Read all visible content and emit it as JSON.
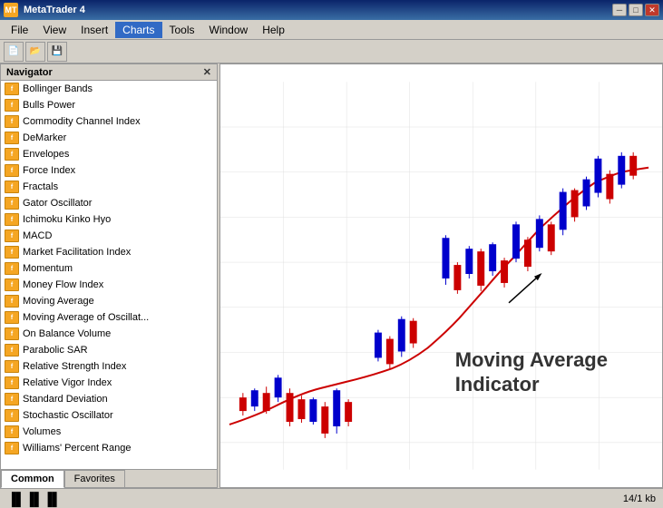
{
  "titleBar": {
    "title": "MetaTrader 4",
    "appIconLabel": "MT"
  },
  "menuBar": {
    "items": [
      "File",
      "View",
      "Insert",
      "Charts",
      "Tools",
      "Window",
      "Help"
    ]
  },
  "navigator": {
    "title": "Navigator",
    "indicators": [
      "Bollinger Bands",
      "Bulls Power",
      "Commodity Channel Index",
      "DeMarker",
      "Envelopes",
      "Force Index",
      "Fractals",
      "Gator Oscillator",
      "Ichimoku Kinko Hyo",
      "MACD",
      "Market Facilitation Index",
      "Momentum",
      "Money Flow Index",
      "Moving Average",
      "Moving Average of Oscillat...",
      "On Balance Volume",
      "Parabolic SAR",
      "Relative Strength Index",
      "Relative Vigor Index",
      "Standard Deviation",
      "Stochastic Oscillator",
      "Volumes",
      "Williams' Percent Range"
    ],
    "tabs": [
      "Common",
      "Favorites"
    ]
  },
  "chartLabel": {
    "line1": "Moving Average",
    "line2": "Indicator"
  },
  "statusBar": {
    "info": "14/1 kb"
  }
}
